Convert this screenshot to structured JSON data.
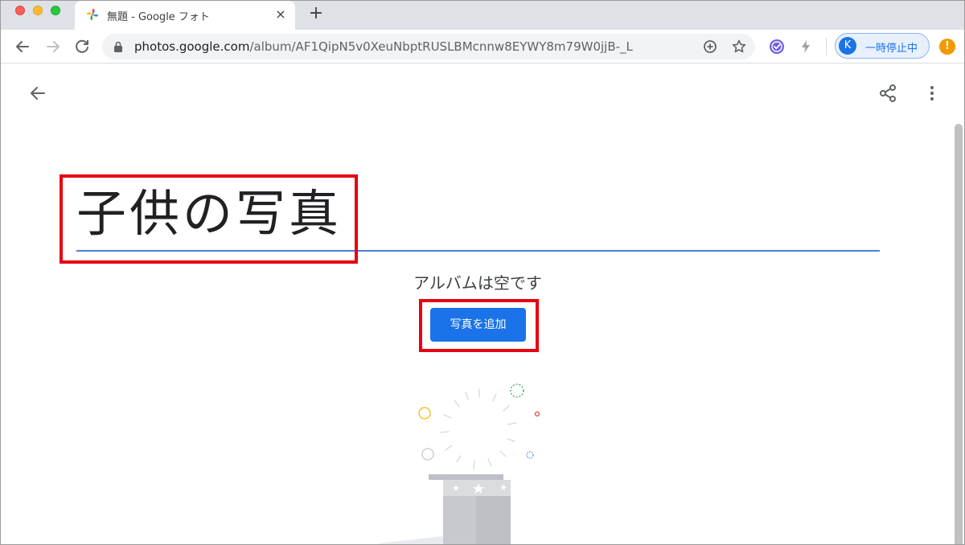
{
  "browser": {
    "tab_title": "無題 - Google フォト",
    "tab_close": "×",
    "new_tab": "+",
    "url_host": "photos.google.com",
    "url_path": "/album/AF1QipN5v0XeuNbptRUSLBMcnnw8EYWY8m79W0jjB-_L",
    "profile_initial": "K",
    "profile_label": "一時停止中",
    "alert_label": "!"
  },
  "page": {
    "album_title": "子供の写真",
    "empty_text": "アルバムは空です",
    "add_photos_label": "写真を追加"
  },
  "colors": {
    "accent": "#1a73e8",
    "title_underline": "#4a7fd6",
    "annotation": "#e60012"
  },
  "icons": {
    "back": "arrow-left-icon",
    "share": "share-icon",
    "more": "more-vert-icon"
  }
}
